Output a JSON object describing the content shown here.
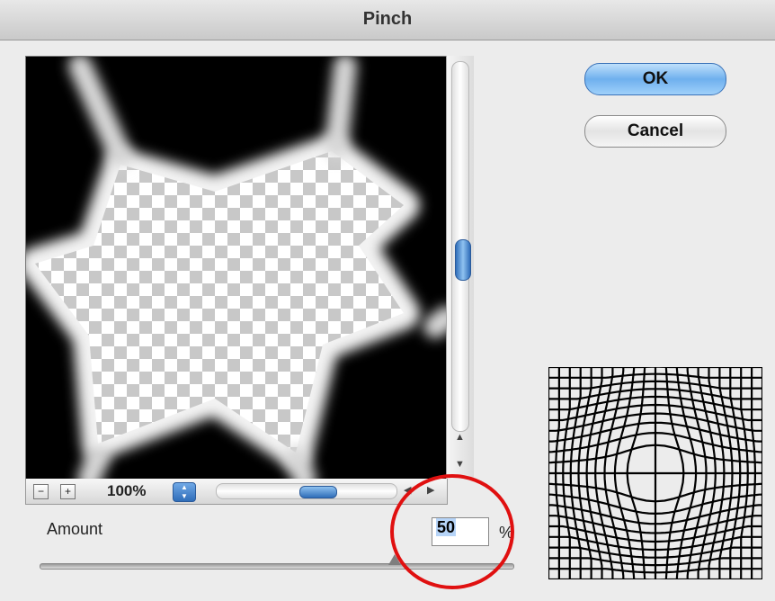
{
  "window": {
    "title": "Pinch"
  },
  "buttons": {
    "ok": "OK",
    "cancel": "Cancel"
  },
  "zoom": {
    "level": "100%",
    "minus_icon": "minus-icon",
    "plus_icon": "plus-icon"
  },
  "amount": {
    "label": "Amount",
    "value": "50",
    "unit": "%",
    "slider_fraction": 0.75
  },
  "colors": {
    "accent": "#2f6db9",
    "highlight_circle": "#e01010"
  }
}
